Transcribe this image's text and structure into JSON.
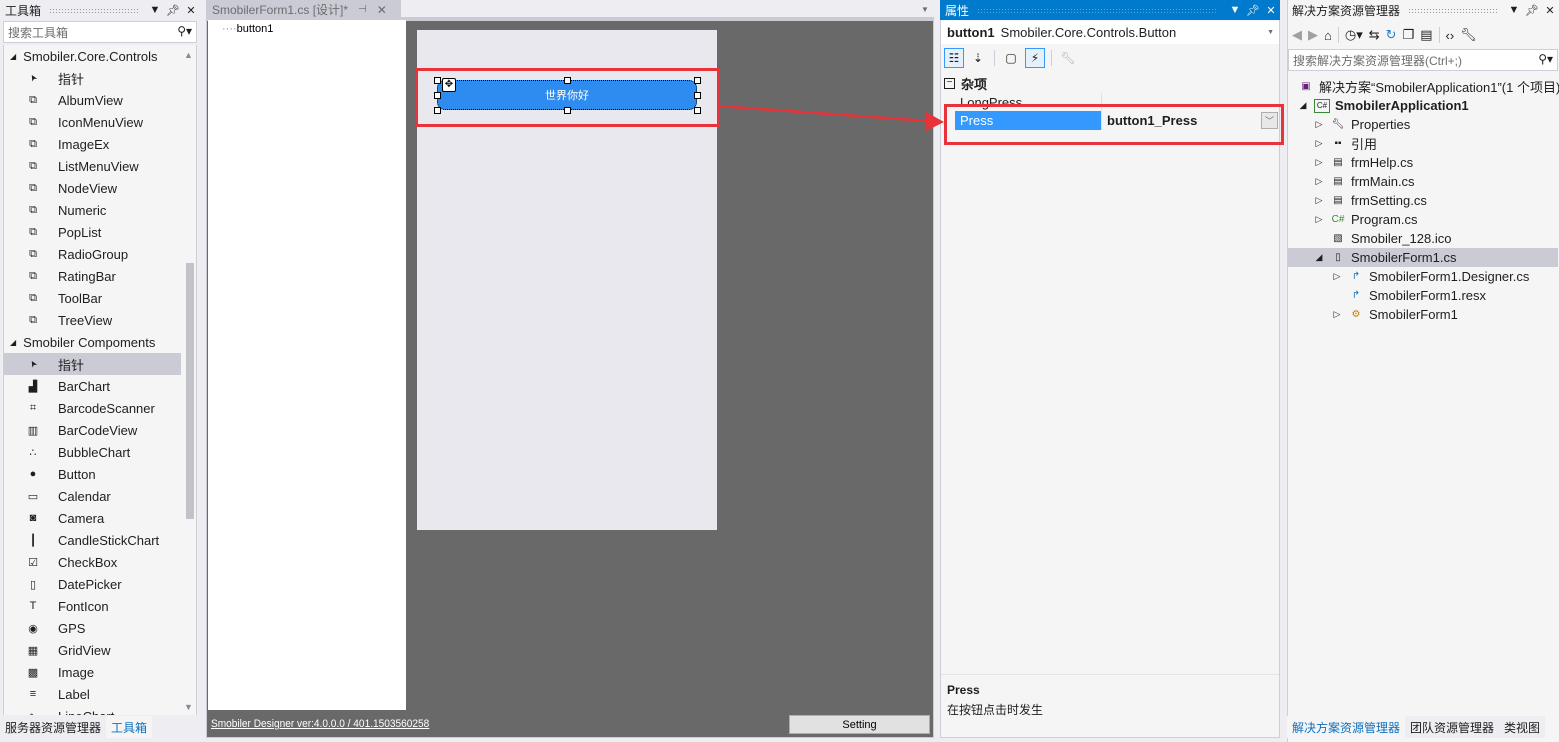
{
  "toolbox": {
    "title": "工具箱",
    "search_placeholder": "搜索工具箱",
    "groups": [
      {
        "label": "Smobiler.Core.Controls",
        "items": [
          {
            "label": "指针",
            "icon": "pointer-icon"
          },
          {
            "label": "AlbumView",
            "icon": "component-icon"
          },
          {
            "label": "IconMenuView",
            "icon": "component-icon"
          },
          {
            "label": "ImageEx",
            "icon": "component-icon"
          },
          {
            "label": "ListMenuView",
            "icon": "component-icon"
          },
          {
            "label": "NodeView",
            "icon": "component-icon"
          },
          {
            "label": "Numeric",
            "icon": "component-icon"
          },
          {
            "label": "PopList",
            "icon": "component-icon"
          },
          {
            "label": "RadioGroup",
            "icon": "component-icon"
          },
          {
            "label": "RatingBar",
            "icon": "component-icon"
          },
          {
            "label": "ToolBar",
            "icon": "component-icon"
          },
          {
            "label": "TreeView",
            "icon": "component-icon"
          }
        ]
      },
      {
        "label": "Smobiler Compoments",
        "items": [
          {
            "label": "指针",
            "icon": "pointer-icon",
            "selected": true
          },
          {
            "label": "BarChart",
            "icon": "bar-chart-icon"
          },
          {
            "label": "BarcodeScanner",
            "icon": "scanner-icon"
          },
          {
            "label": "BarCodeView",
            "icon": "barcode-icon"
          },
          {
            "label": "BubbleChart",
            "icon": "bubble-chart-icon"
          },
          {
            "label": "Button",
            "icon": "button-icon"
          },
          {
            "label": "Calendar",
            "icon": "calendar-icon"
          },
          {
            "label": "Camera",
            "icon": "camera-icon"
          },
          {
            "label": "CandleStickChart",
            "icon": "candlestick-icon"
          },
          {
            "label": "CheckBox",
            "icon": "checkbox-icon"
          },
          {
            "label": "DatePicker",
            "icon": "datepicker-icon"
          },
          {
            "label": "FontIcon",
            "icon": "font-icon"
          },
          {
            "label": "GPS",
            "icon": "gps-icon"
          },
          {
            "label": "GridView",
            "icon": "grid-icon"
          },
          {
            "label": "Image",
            "icon": "image-icon"
          },
          {
            "label": "Label",
            "icon": "label-icon"
          },
          {
            "label": "LineChart",
            "icon": "line-chart-icon"
          }
        ]
      }
    ],
    "bottom_tabs": [
      "服务器资源管理器",
      "工具箱"
    ]
  },
  "document": {
    "tab_label": "SmobilerForm1.cs [设计]*",
    "tree_node": "button1",
    "button_text": "世界你好",
    "version_link": "Smobiler Designer ver:4.0.0.0 / 401.1503560258",
    "setting_button": "Setting"
  },
  "properties": {
    "title": "属性",
    "object_name": "button1",
    "object_type": "Smobiler.Core.Controls.Button",
    "category": "杂项",
    "rows": [
      {
        "name": "LongPress",
        "value": ""
      },
      {
        "name": "Press",
        "value": "button1_Press",
        "selected": true
      }
    ],
    "description_title": "Press",
    "description_text": "在按钮点击时发生"
  },
  "solution_explorer": {
    "title": "解决方案资源管理器",
    "search_placeholder": "搜索解决方案资源管理器(Ctrl+;)",
    "solution_label": "解决方案“SmobilerApplication1”(1 个项目)",
    "project_label": "SmobilerApplication1",
    "items": [
      {
        "label": "Properties",
        "icon": "wrench-icon",
        "expandable": true,
        "level": 2
      },
      {
        "label": "引用",
        "icon": "references-icon",
        "expandable": true,
        "level": 2
      },
      {
        "label": "frmHelp.cs",
        "icon": "form-icon",
        "expandable": true,
        "level": 2
      },
      {
        "label": "frmMain.cs",
        "icon": "form-icon",
        "expandable": true,
        "level": 2
      },
      {
        "label": "frmSetting.cs",
        "icon": "form-icon",
        "expandable": true,
        "level": 2
      },
      {
        "label": "Program.cs",
        "icon": "csharp-icon",
        "expandable": true,
        "level": 2
      },
      {
        "label": "Smobiler_128.ico",
        "icon": "ico-file-icon",
        "expandable": false,
        "level": 2
      },
      {
        "label": "SmobilerForm1.cs",
        "icon": "file-icon",
        "expandable": true,
        "expanded": true,
        "selected": true,
        "level": 2
      },
      {
        "label": "SmobilerForm1.Designer.cs",
        "icon": "code-file-icon",
        "expandable": true,
        "level": 3
      },
      {
        "label": "SmobilerForm1.resx",
        "icon": "code-file-icon",
        "expandable": false,
        "level": 3
      },
      {
        "label": "SmobilerForm1",
        "icon": "class-icon",
        "expandable": true,
        "level": 3
      }
    ],
    "bottom_tabs": [
      "解决方案资源管理器",
      "团队资源管理器",
      "类视图"
    ]
  },
  "colors": {
    "accent": "#007acc",
    "selection": "#3399ff",
    "highlight_red": "#e8333a",
    "button_blue": "#2e8cf0"
  }
}
